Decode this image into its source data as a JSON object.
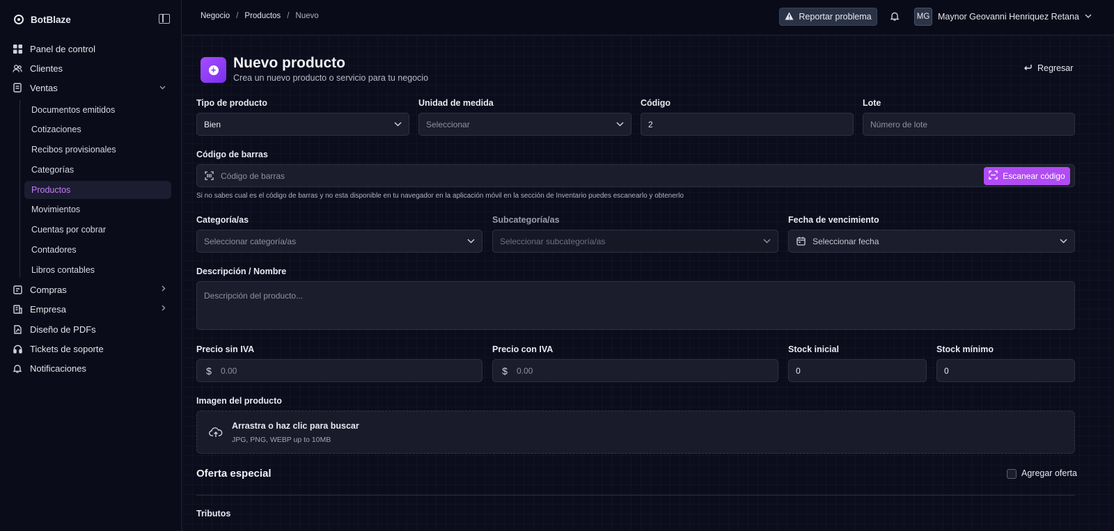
{
  "app": {
    "name": "BotBlaze"
  },
  "sidebar": {
    "items": [
      {
        "label": "Panel de control",
        "icon": "dashboard-icon"
      },
      {
        "label": "Clientes",
        "icon": "users-icon"
      },
      {
        "label": "Ventas",
        "icon": "receipt-icon",
        "expanded": true
      },
      {
        "label": "Compras",
        "icon": "cart-icon"
      },
      {
        "label": "Empresa",
        "icon": "building-icon"
      },
      {
        "label": "Diseño de PDFs",
        "icon": "file-design-icon"
      },
      {
        "label": "Tickets de soporte",
        "icon": "headset-icon"
      },
      {
        "label": "Notificaciones",
        "icon": "bell-icon"
      }
    ],
    "ventas_sub": [
      {
        "label": "Documentos emitidos"
      },
      {
        "label": "Cotizaciones"
      },
      {
        "label": "Recibos provisionales"
      },
      {
        "label": "Categorías"
      },
      {
        "label": "Productos",
        "active": true
      },
      {
        "label": "Movimientos"
      },
      {
        "label": "Cuentas por cobrar"
      },
      {
        "label": "Contadores"
      },
      {
        "label": "Libros contables"
      }
    ],
    "active_color": "#c77dff"
  },
  "header": {
    "breadcrumb": [
      "Negocio",
      "Productos",
      "Nuevo"
    ],
    "report_label": "Reportar problema",
    "avatar_initials": "MG",
    "user_name": "Maynor Geovanni Henriquez Retana"
  },
  "page": {
    "title": "Nuevo producto",
    "subtitle": "Crea un nuevo producto o servicio para tu negocio",
    "back_label": "Regresar",
    "accent": "#b14cf5"
  },
  "form": {
    "tipo": {
      "label": "Tipo de producto",
      "value": "Bien"
    },
    "unidad": {
      "label": "Unidad de medida",
      "placeholder": "Seleccionar"
    },
    "codigo": {
      "label": "Código",
      "value": "2"
    },
    "lote": {
      "label": "Lote",
      "placeholder": "Número de lote"
    },
    "barcode": {
      "label": "Código de barras",
      "placeholder": "Código de barras",
      "scan_label": "Escanear código",
      "hint": "Si no sabes cual es el código de barras y no esta disponible en tu navegador en la aplicación móvil en la sección de Inventario puedes escanearlo y obtenerlo"
    },
    "categoria": {
      "label": "Categoría/as",
      "placeholder": "Seleccionar categoría/as"
    },
    "subcategoria": {
      "label": "Subcategoría/as",
      "placeholder": "Seleccionar subcategoría/as"
    },
    "vencimiento": {
      "label": "Fecha de vencimiento",
      "placeholder": "Seleccionar fecha"
    },
    "descripcion": {
      "label": "Descripción / Nombre",
      "placeholder": "Descripción del producto..."
    },
    "precio_sin": {
      "label": "Precio sin IVA",
      "placeholder": "0.00"
    },
    "precio_con": {
      "label": "Precio con IVA",
      "placeholder": "0.00"
    },
    "stock_inicial": {
      "label": "Stock inicial",
      "value": "0"
    },
    "stock_minimo": {
      "label": "Stock mínimo",
      "value": "0"
    },
    "imagen": {
      "label": "Imagen del producto",
      "title": "Arrastra o haz clic para buscar",
      "formats": "JPG, PNG, WEBP up to 10MB"
    },
    "oferta": {
      "title": "Oferta especial",
      "checkbox_label": "Agregar oferta",
      "checked": false
    },
    "tributos_label": "Tributos"
  }
}
